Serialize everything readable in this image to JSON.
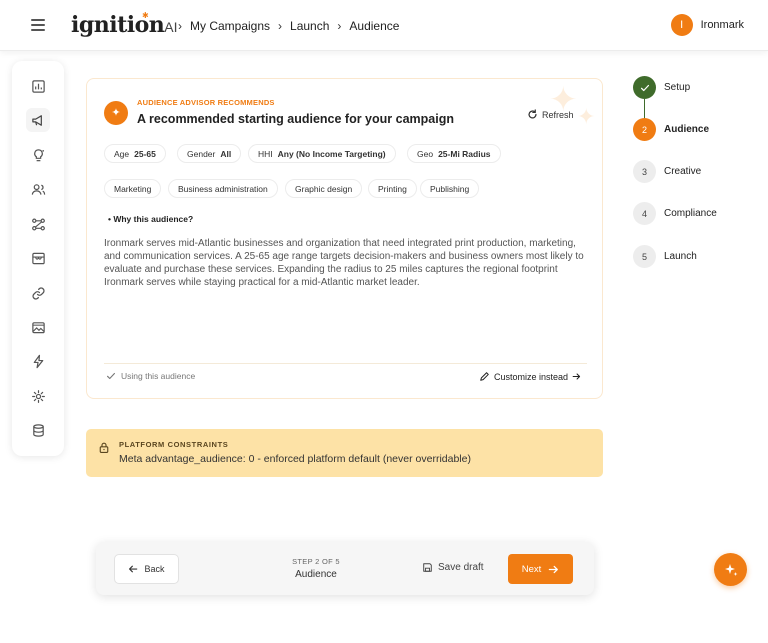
{
  "header": {
    "logo_text": "ignition",
    "logo_suffix": "AI",
    "breadcrumbs": [
      "My Campaigns",
      "Launch",
      "Audience"
    ],
    "user_initial": "I",
    "user_name": "Ironmark"
  },
  "sidebar": {
    "items": [
      {
        "icon": "chart-icon"
      },
      {
        "icon": "megaphone-icon",
        "active": true
      },
      {
        "icon": "lightbulb-icon"
      },
      {
        "icon": "users-icon"
      },
      {
        "icon": "workflow-icon"
      },
      {
        "icon": "storefront-icon"
      },
      {
        "icon": "link-icon"
      },
      {
        "icon": "image-icon"
      },
      {
        "icon": "lightning-icon"
      },
      {
        "icon": "gear-icon"
      },
      {
        "icon": "database-icon"
      }
    ]
  },
  "card": {
    "eyebrow": "AUDIENCE ADVISOR RECOMMENDS",
    "title": "A recommended starting audience for your campaign",
    "refresh_label": "Refresh",
    "chips_row1": [
      {
        "k": "Age",
        "v": "25-65"
      },
      {
        "k": "Gender",
        "v": "All"
      },
      {
        "k": "HHI",
        "v": "Any (No Income Targeting)"
      },
      {
        "k": "Geo",
        "v": "25-Mi Radius"
      }
    ],
    "chips_row2": [
      "Marketing",
      "Business administration",
      "Graphic design",
      "Printing",
      "Publishing"
    ],
    "why_label": "• Why this audience?",
    "description": "Ironmark serves mid-Atlantic businesses and organization that need integrated print production, marketing, and communication services. A 25-65 age range targets decision-makers and business owners most likely to evaluate and purchase these services. Expanding the radius to 25 miles captures the regional footprint Ironmark serves while staying practical for a mid-Atlantic market leader.",
    "using_label": "Using this audience",
    "customize_label": "Customize instead"
  },
  "constraints": {
    "title": "PLATFORM CONSTRAINTS",
    "text": "Meta advantage_audience: 0 - enforced platform default (never overridable)"
  },
  "stepper": {
    "steps": [
      {
        "num": "",
        "label": "Setup",
        "state": "done"
      },
      {
        "num": "2",
        "label": "Audience",
        "state": "current"
      },
      {
        "num": "3",
        "label": "Creative",
        "state": "pending"
      },
      {
        "num": "4",
        "label": "Compliance",
        "state": "pending"
      },
      {
        "num": "5",
        "label": "Launch",
        "state": "pending"
      }
    ]
  },
  "footer": {
    "back_label": "Back",
    "step_counter": "STEP 2 OF 5",
    "step_name": "Audience",
    "save_label": "Save draft",
    "next_label": "Next"
  },
  "colors": {
    "accent": "#f07c13",
    "done_green": "#3f6b2b",
    "constraint_bg": "#fde2a6"
  }
}
